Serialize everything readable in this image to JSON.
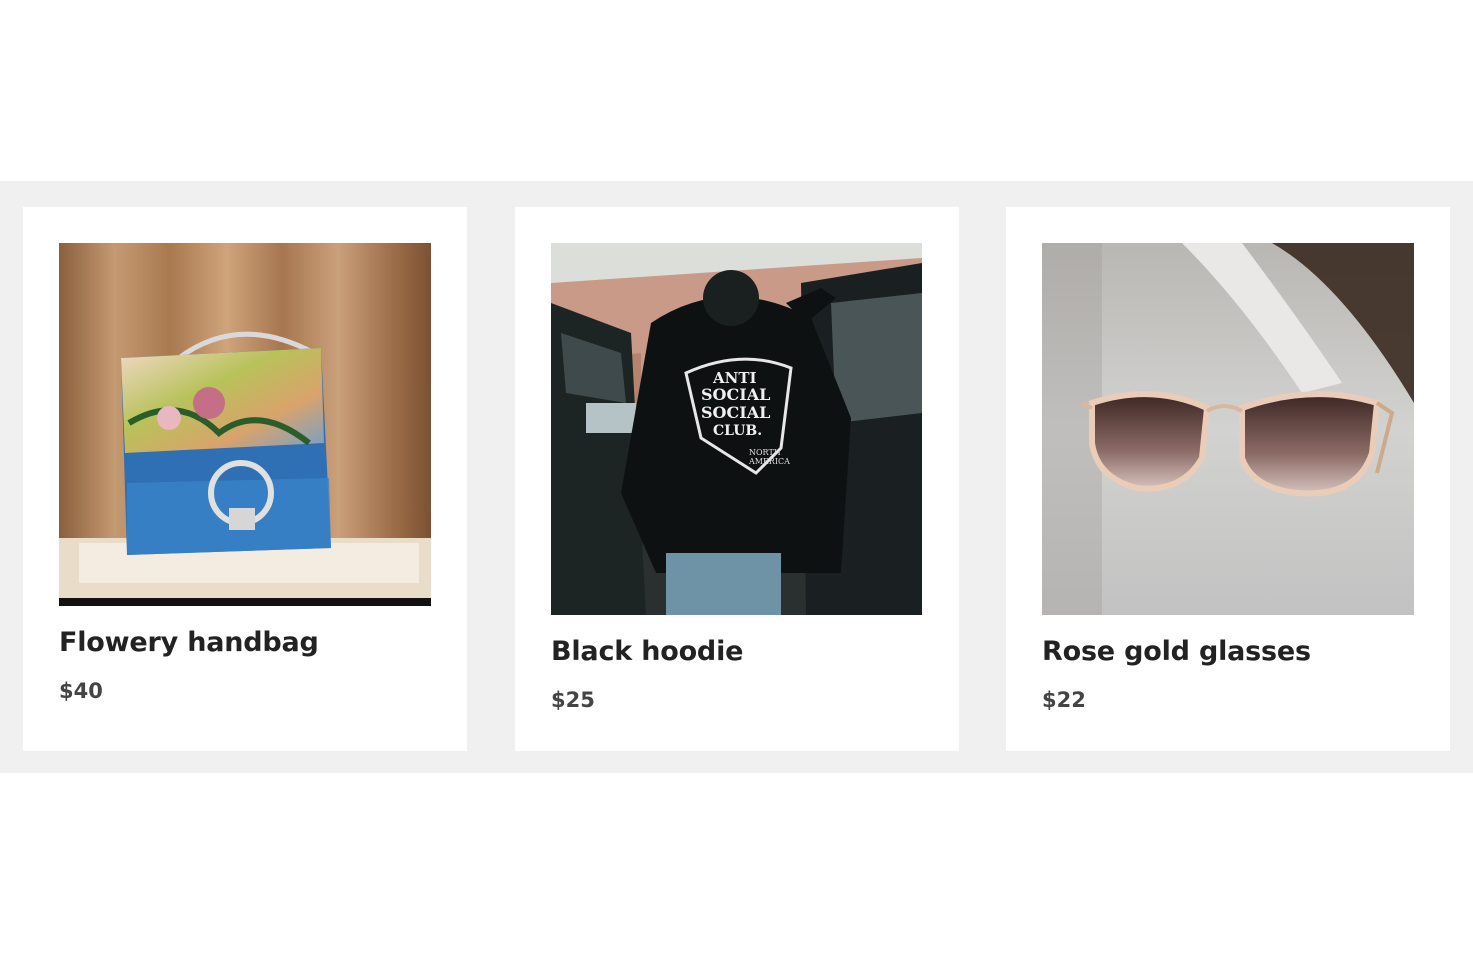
{
  "products": [
    {
      "title": "Flowery handbag",
      "price": "$40",
      "image_icon": "handbag-photo"
    },
    {
      "title": "Black hoodie",
      "price": "$25",
      "image_icon": "hoodie-photo",
      "print_text": [
        "ANTI",
        "SOCIAL",
        "SOCIAL",
        "CLUB.",
        "NORTH",
        "AMERICA"
      ]
    },
    {
      "title": "Rose gold glasses",
      "price": "$22",
      "image_icon": "sunglasses-photo"
    }
  ],
  "colors": {
    "band": "#f0f0f0",
    "card": "#ffffff",
    "title": "#222222",
    "price": "#444444"
  }
}
